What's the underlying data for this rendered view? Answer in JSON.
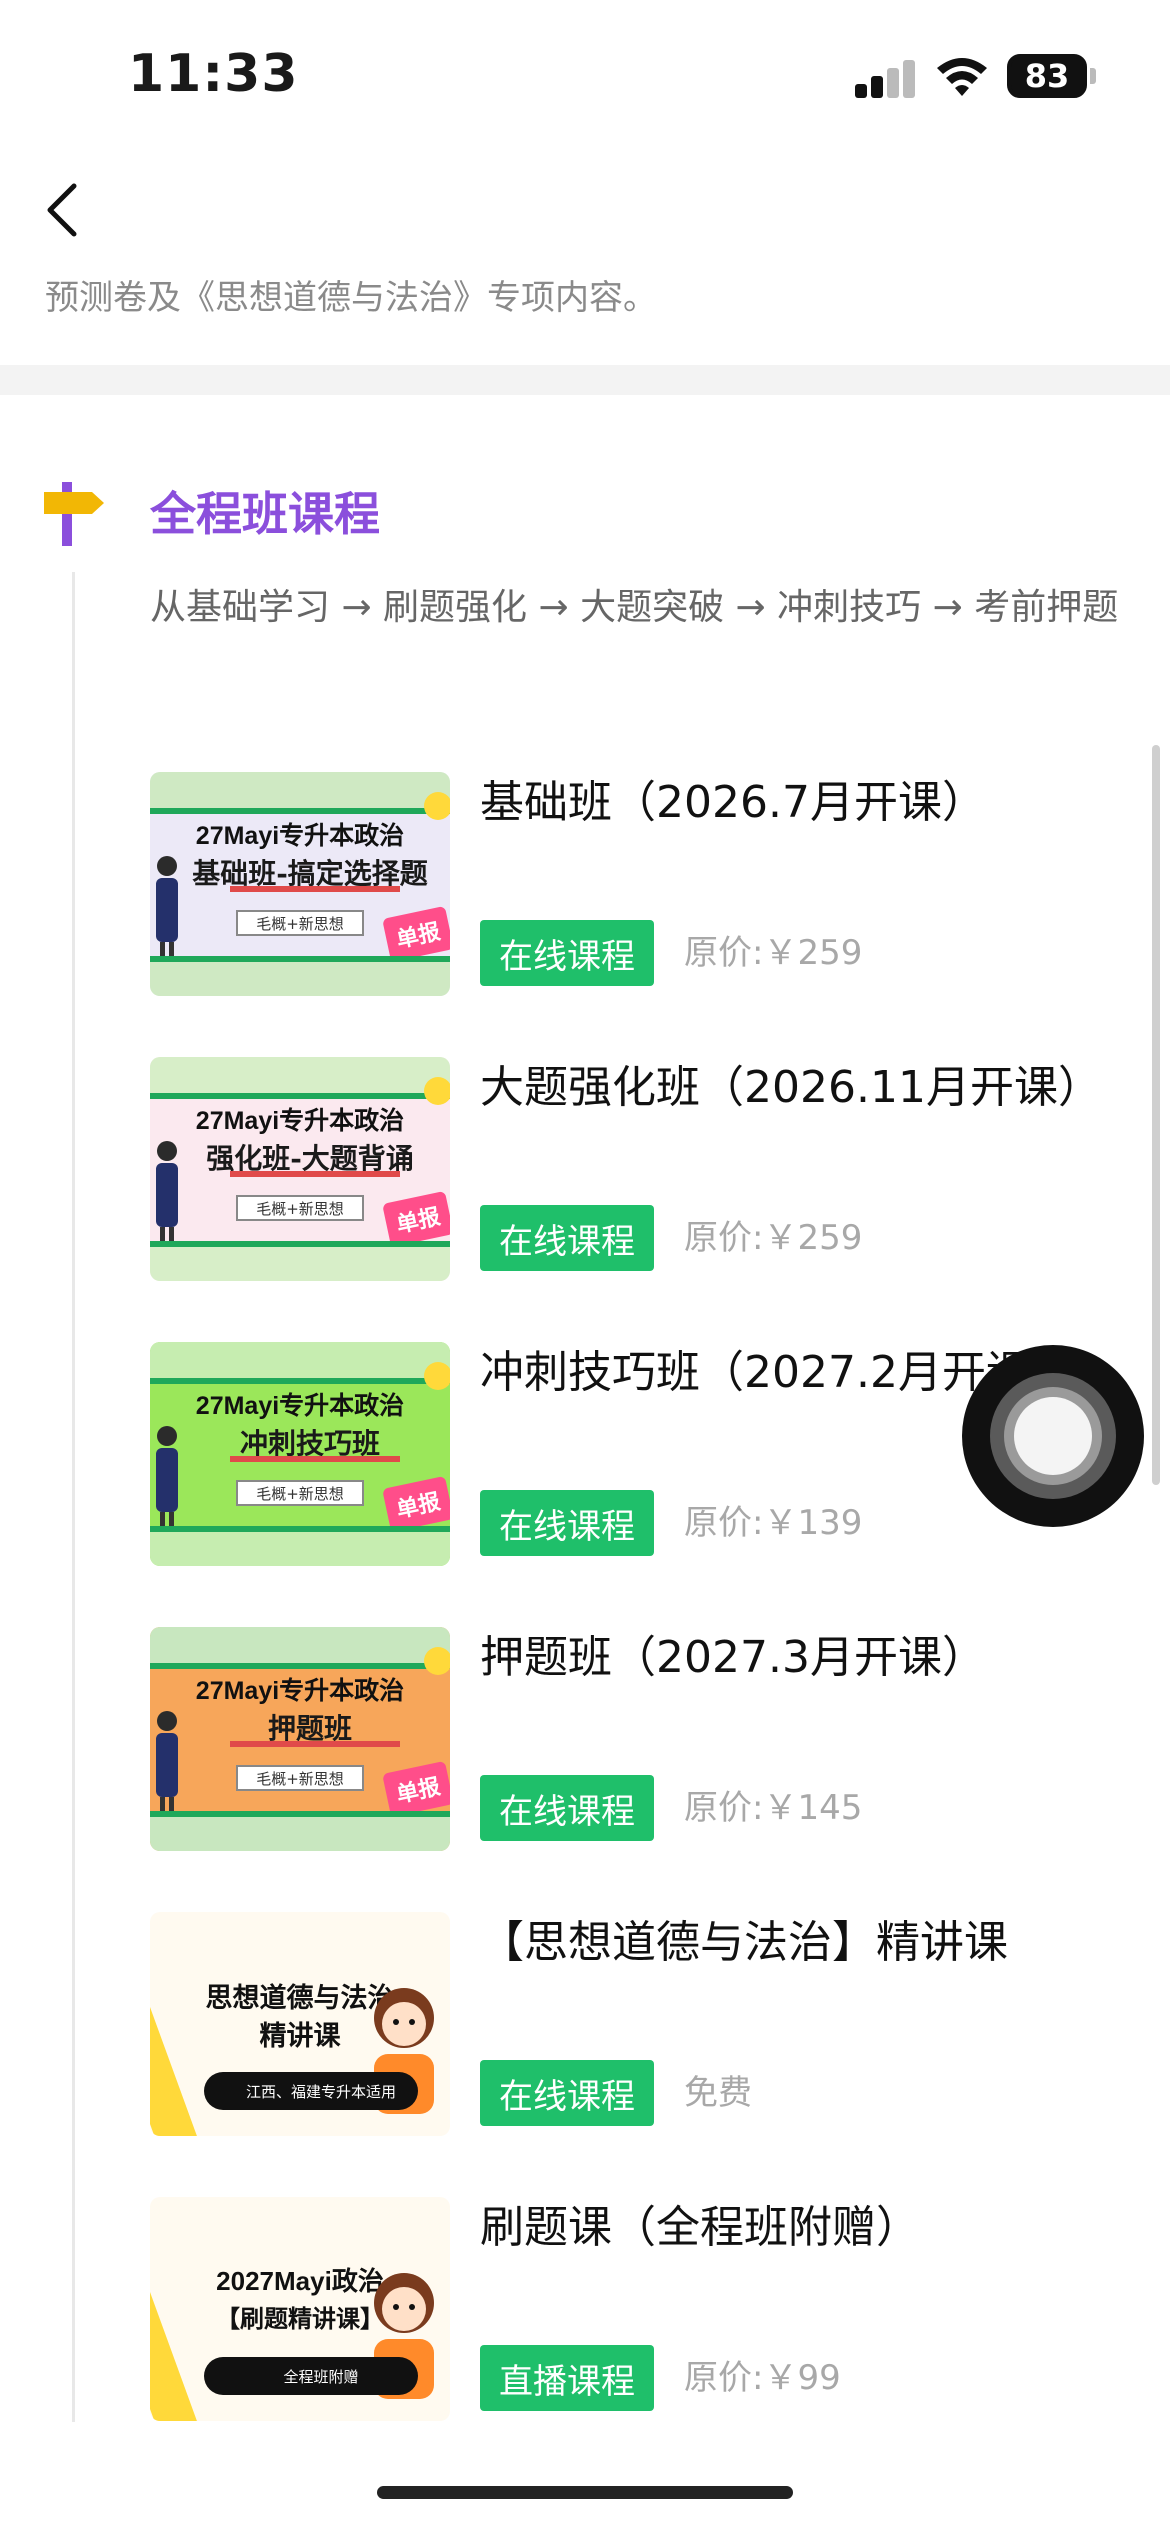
{
  "status_bar": {
    "time": "11:33",
    "battery": "83"
  },
  "header": {
    "intro": "预测卷及《思想道德与法治》专项内容。"
  },
  "section": {
    "title": "全程班课程",
    "path": "从基础学习 → 刷题强化 → 大题突破 → 冲刺技巧 → 考前押题",
    "accent_color": "#8b4fdc",
    "flag_color": "#f2b705"
  },
  "courses": [
    {
      "title": "基础班（2026.7月开课）",
      "tag": "在线课程",
      "price": "原价:￥259",
      "thumb": {
        "head": "27Mayi专升本政治",
        "main": "基础班-搞定选择题",
        "sub": "毛概+新思想",
        "stamp": "单报",
        "bg": "#ece9f7"
      }
    },
    {
      "title": "大题强化班（2026.11月开课）",
      "tag": "在线课程",
      "price": "原价:￥259",
      "thumb": {
        "head": "27Mayi专升本政治",
        "main": "强化班-大题背诵",
        "sub": "毛概+新思想",
        "stamp": "单报",
        "bg": "#fbe9ef"
      }
    },
    {
      "title": "冲刺技巧班（2027.2月开课）",
      "tag": "在线课程",
      "price": "原价:￥139",
      "thumb": {
        "head": "27Mayi专升本政治",
        "main": "冲刺技巧班",
        "sub": "毛概+新思想",
        "stamp": "单报",
        "bg": "#9be75a"
      }
    },
    {
      "title": "押题班（2027.3月开课）",
      "tag": "在线课程",
      "price": "原价:￥145",
      "thumb": {
        "head": "27Mayi专升本政治",
        "main": "押题班",
        "sub": "毛概+新思想",
        "stamp": "单报",
        "bg": "#f7a65a"
      }
    },
    {
      "title": "【思想道德与法治】精讲课",
      "tag": "在线课程",
      "price": "免费",
      "thumb": {
        "line1": "思想道德与法治",
        "line2": "精讲课",
        "pill": "江西、福建专升本适用"
      }
    },
    {
      "title": "刷题课（全程班附赠）",
      "tag": "直播课程",
      "price": "原价:￥99",
      "thumb": {
        "line1": "2027Mayi政治",
        "line2": "【刷题精讲课】",
        "pill": "全程班附赠"
      }
    }
  ]
}
